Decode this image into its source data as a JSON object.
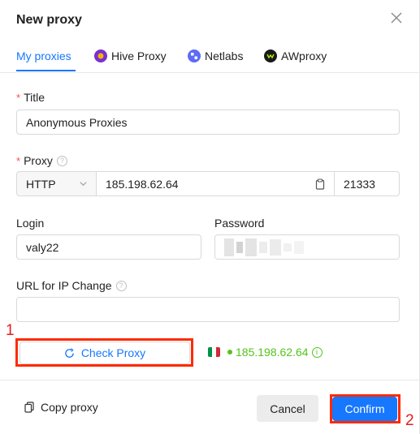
{
  "dialog": {
    "title": "New proxy"
  },
  "tabs": [
    {
      "label": "My proxies",
      "icon": "none",
      "active": true
    },
    {
      "label": "Hive Proxy",
      "icon": "hive-proxy-logo-icon",
      "color": "#7b2fd0"
    },
    {
      "label": "Netlabs",
      "icon": "netlabs-logo-icon",
      "color": "#5d6bf5"
    },
    {
      "label": "AWproxy",
      "icon": "awproxy-logo-icon",
      "color": "#1a1a1a"
    }
  ],
  "form": {
    "title_label": "Title",
    "title_value": "Anonymous Proxies",
    "proxy_label": "Proxy",
    "protocol_value": "HTTP",
    "host_value": "185.198.62.64",
    "port_value": "21333",
    "login_label": "Login",
    "login_value": "valy22",
    "password_label": "Password",
    "url_change_label": "URL for IP Change",
    "url_change_value": "",
    "required_mark": "*",
    "help_glyph": "?"
  },
  "check": {
    "button_label": "Check Proxy",
    "result_ip": "185.198.62.64",
    "result_country_flag": "italy-flag-icon",
    "result_color": "#52c41a",
    "info_glyph": "i"
  },
  "footer": {
    "copy_label": "Copy proxy",
    "cancel_label": "Cancel",
    "confirm_label": "Confirm"
  },
  "annotations": {
    "marker_1": "1",
    "marker_2": "2",
    "highlight_color": "#ff2a00"
  },
  "colors": {
    "accent": "#1677ff",
    "required": "#ff4d4f"
  }
}
